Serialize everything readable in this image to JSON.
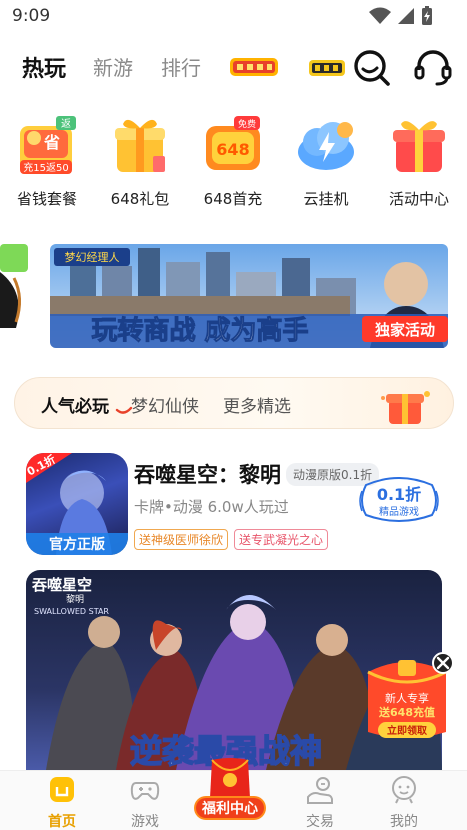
{
  "status_bar": {
    "time": "9:09"
  },
  "top_tabs": [
    {
      "label": "热玩",
      "active": true
    },
    {
      "label": "新游",
      "active": false
    },
    {
      "label": "排行",
      "active": false
    }
  ],
  "quick_entries": [
    {
      "label": "省钱套餐",
      "icon": "money-saving-icon",
      "icon_text_top": "省",
      "icon_text_badge": "返",
      "icon_text_bottom": "充15返50"
    },
    {
      "label": "648礼包",
      "icon": "gift-box-icon"
    },
    {
      "label": "648首充",
      "icon": "first-charge-icon",
      "icon_text_top": "免费",
      "icon_text_bottom": "648"
    },
    {
      "label": "云挂机",
      "icon": "cloud-lightning-icon"
    },
    {
      "label": "活动中心",
      "icon": "gift-present-icon"
    }
  ],
  "banner": {
    "headline": "玩转商战 成为高手",
    "tag": "独家活动",
    "logo": "梦幻经理人"
  },
  "categories": [
    {
      "label": "人气必玩",
      "active": true
    },
    {
      "label": "梦幻仙侠",
      "active": false
    },
    {
      "label": "更多精选",
      "active": false
    }
  ],
  "game": {
    "title": "吞噬星空：黎明",
    "tag": "动漫原版0.1折",
    "meta": "卡牌•动漫 6.0w人玩过",
    "badges": [
      "送神级医师徐欣",
      "送专武凝光之心"
    ],
    "discount": "0.1折",
    "discount_sub": "精品游戏",
    "icon_corner": "0.1折",
    "icon_footer": "官方正版"
  },
  "game_art": {
    "logo": "吞噬星空",
    "logo_sub": "黎明",
    "logo_en": "SWALLOWED STAR",
    "slogan": "逆袭最强战神"
  },
  "promo": {
    "line1": "新人专享",
    "line2": "送648充值",
    "button": "立即领取"
  },
  "bottom_nav": [
    {
      "label": "首页",
      "icon": "home-icon",
      "active": true
    },
    {
      "label": "游戏",
      "icon": "gamepad-icon",
      "active": false
    },
    {
      "label": "福利中心",
      "icon": "red-envelope-icon",
      "active": false
    },
    {
      "label": "交易",
      "icon": "trade-icon",
      "active": false
    },
    {
      "label": "我的",
      "icon": "profile-icon",
      "active": false
    }
  ],
  "colors": {
    "accent": "#e8a000",
    "discount_blue": "#2b6fe0",
    "promo_red": "#e8412a"
  }
}
